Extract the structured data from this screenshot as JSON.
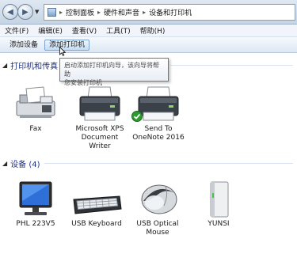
{
  "address_bar": {
    "crumbs": [
      "控制面板",
      "硬件和声音",
      "设备和打印机"
    ]
  },
  "menu": {
    "items": [
      "文件(F)",
      "编辑(E)",
      "查看(V)",
      "工具(T)",
      "帮助(H)"
    ]
  },
  "command_bar": {
    "add_device": "添加设备",
    "add_printer": "添加打印机"
  },
  "tooltip": {
    "line1": "启动添加打印机向导，该向导将帮助",
    "line2": "您安装打印机"
  },
  "printers_section": {
    "title": "打印机和传真",
    "items": [
      {
        "label": "Fax",
        "icon": "fax-icon"
      },
      {
        "label": "Microsoft XPS Document Writer",
        "icon": "printer-icon"
      },
      {
        "label": "Send To OneNote 2016",
        "icon": "printer-icon",
        "default": true
      }
    ]
  },
  "devices_section": {
    "title": "设备 (4)",
    "items": [
      {
        "label": "PHL 223V5",
        "icon": "monitor-icon"
      },
      {
        "label": "USB Keyboard",
        "icon": "keyboard-icon"
      },
      {
        "label": "USB Optical Mouse",
        "icon": "mouse-icon"
      },
      {
        "label": "YUNSI",
        "icon": "external-drive-icon"
      }
    ]
  }
}
